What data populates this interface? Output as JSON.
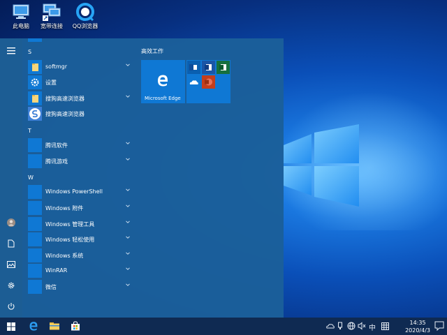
{
  "desktop": {
    "icons": [
      {
        "label": "此电脑",
        "icon": "computer-icon"
      },
      {
        "label": "宽带连接",
        "icon": "network-icon"
      },
      {
        "label": "QQ浏览器",
        "icon": "qq-browser-icon"
      }
    ]
  },
  "start_menu": {
    "rail": [
      "hamburger-icon",
      "user-icon",
      "document-icon",
      "picture-icon",
      "settings-icon",
      "power-icon"
    ],
    "sections": [
      {
        "letter": "S",
        "apps": [
          {
            "name": "softmgr",
            "icon": "folder-icon",
            "expandable": true
          },
          {
            "name": "设置",
            "icon": "gear-icon",
            "expandable": false
          },
          {
            "name": "搜狗高速浏览器",
            "icon": "folder-icon",
            "expandable": true
          },
          {
            "name": "搜狗高速浏览器",
            "icon": "sogou-browser-icon",
            "expandable": false
          }
        ]
      },
      {
        "letter": "T",
        "apps": [
          {
            "name": "腾讯软件",
            "icon": "folder-icon",
            "expandable": true
          },
          {
            "name": "腾讯游戏",
            "icon": "folder-icon",
            "expandable": true
          }
        ]
      },
      {
        "letter": "W",
        "apps": [
          {
            "name": "Windows PowerShell",
            "icon": "folder-icon",
            "expandable": true
          },
          {
            "name": "Windows 附件",
            "icon": "folder-icon",
            "expandable": true
          },
          {
            "name": "Windows 管理工具",
            "icon": "folder-icon",
            "expandable": true
          },
          {
            "name": "Windows 轻松使用",
            "icon": "folder-icon",
            "expandable": true
          },
          {
            "name": "Windows 系统",
            "icon": "folder-icon",
            "expandable": true
          },
          {
            "name": "WinRAR",
            "icon": "folder-icon",
            "expandable": true
          },
          {
            "name": "微信",
            "icon": "folder-icon",
            "expandable": true
          }
        ]
      }
    ],
    "tiles_group_title": "高效工作",
    "edge_tile_label": "Microsoft Edge",
    "office_tiles": [
      "outlook-icon",
      "word-icon",
      "excel-icon",
      "onedrive-icon",
      "powerpoint-icon"
    ]
  },
  "taskbar": {
    "pinned": [
      "start-icon",
      "edge-icon",
      "file-explorer-icon",
      "store-icon"
    ],
    "tray": {
      "ime": "中",
      "time": "14:35",
      "date": "2020/4/3"
    }
  },
  "colors": {
    "accent": "#0f78d4",
    "menu_bg": "#1b5f9a",
    "taskbar_bg": "#0f2a52"
  }
}
